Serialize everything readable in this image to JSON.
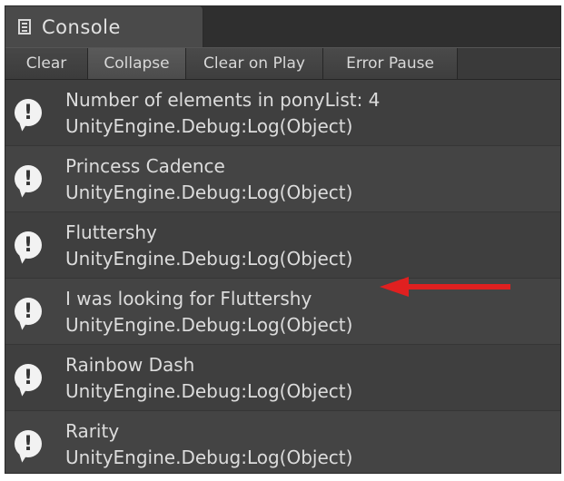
{
  "window": {
    "tab_title": "Console"
  },
  "toolbar": {
    "clear": "Clear",
    "collapse": "Collapse",
    "clear_on_play": "Clear on Play",
    "error_pause": "Error Pause"
  },
  "entries": [
    {
      "message": "Number of elements in ponyList: 4",
      "trace": "UnityEngine.Debug:Log(Object)"
    },
    {
      "message": "Princess Cadence",
      "trace": "UnityEngine.Debug:Log(Object)"
    },
    {
      "message": "Fluttershy",
      "trace": "UnityEngine.Debug:Log(Object)"
    },
    {
      "message": "I was looking for Fluttershy",
      "trace": "UnityEngine.Debug:Log(Object)"
    },
    {
      "message": "Rainbow Dash",
      "trace": "UnityEngine.Debug:Log(Object)"
    },
    {
      "message": "Rarity",
      "trace": "UnityEngine.Debug:Log(Object)"
    }
  ],
  "icons": {
    "tab": "console-window-icon",
    "entry": "info-message-icon",
    "annotation": "red-arrow-icon"
  },
  "colors": {
    "annotation_arrow": "#e02020",
    "panel_bg": "#3f3f3f",
    "text": "#dcdcdc"
  }
}
